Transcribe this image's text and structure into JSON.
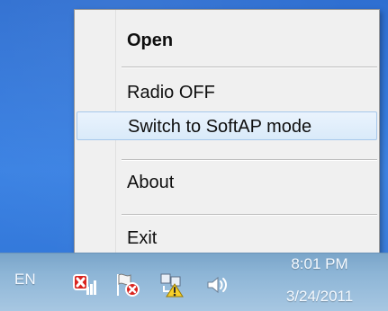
{
  "context_menu": {
    "items": [
      {
        "label": "Open",
        "bold": true
      },
      {
        "label": "Radio OFF"
      },
      {
        "label": "Switch to SoftAP mode",
        "highlighted": true
      },
      {
        "label": "About"
      },
      {
        "label": "Exit"
      }
    ]
  },
  "taskbar": {
    "language": "EN",
    "tray_icons": [
      "wifi-error-icon",
      "flag-error-icon",
      "network-warning-icon",
      "volume-icon"
    ],
    "clock": {
      "time": "8:01 PM",
      "date": "3/24/2011"
    }
  },
  "colors": {
    "desktop": "#2f73d5",
    "menu_background": "#f0f0f0",
    "highlight": "#d9eaf9",
    "highlight_border": "#a6c7ea"
  }
}
